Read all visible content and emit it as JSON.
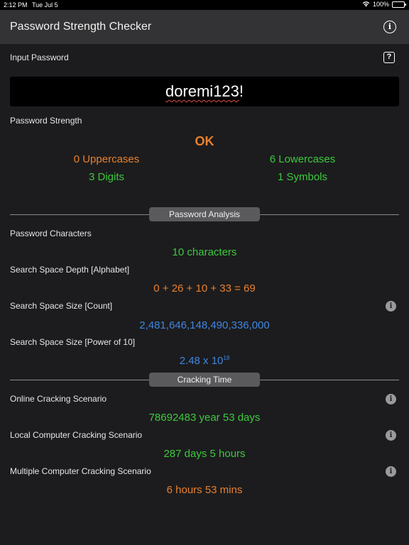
{
  "status": {
    "time": "2:12 PM",
    "date": "Tue Jul 5",
    "battery": "100%"
  },
  "nav": {
    "title": "Password Strength Checker"
  },
  "input": {
    "label": "Input Password",
    "value": "doremi123",
    "value_suffix": "!",
    "help_label": "?"
  },
  "strength": {
    "label": "Password Strength",
    "rating": "OK",
    "uppercases": "0 Uppercases",
    "lowercases": "6 Lowercases",
    "digits": "3 Digits",
    "symbols": "1 Symbols"
  },
  "analysis": {
    "header": "Password Analysis",
    "characters_label": "Password Characters",
    "characters_value": "10 characters",
    "depth_label": "Search Space Depth [Alphabet]",
    "depth_value": "0 + 26 + 10 + 33 = 69",
    "size_count_label": "Search Space Size [Count]",
    "size_count_value": "2,481,646,148,490,336,000",
    "size_power_label": "Search Space Size [Power of 10]",
    "size_power_mantissa": "2.48 x 10",
    "size_power_exponent": "18"
  },
  "cracking": {
    "header": "Cracking Time",
    "online_label": "Online Cracking Scenario",
    "online_value": "78692483 year 53 days",
    "local_label": "Local Computer Cracking Scenario",
    "local_value": "287 days 5 hours",
    "multi_label": "Multiple Computer Cracking Scenario",
    "multi_value": "6 hours 53 mins"
  },
  "colors": {
    "orange": "#e8802e",
    "green": "#3cc93c",
    "blue": "#3f86e0",
    "background": "#1c1c1e",
    "nav": "#333335"
  },
  "icons": {
    "nav_info": "info-circle-icon",
    "help": "question-square-icon",
    "row_info": "info-fill-icon"
  }
}
